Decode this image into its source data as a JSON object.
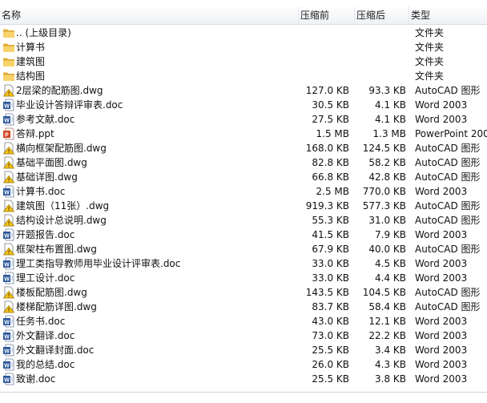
{
  "columns": {
    "name": "名称",
    "size": "压缩前",
    "compressed": "压缩后",
    "type": "类型"
  },
  "rows": [
    {
      "name": ".. (上级目录)",
      "size": "",
      "compressed": "",
      "type": "文件夹",
      "icon": "folder-icon"
    },
    {
      "name": "计算书",
      "size": "",
      "compressed": "",
      "type": "文件夹",
      "icon": "folder-icon"
    },
    {
      "name": "建筑图",
      "size": "",
      "compressed": "",
      "type": "文件夹",
      "icon": "folder-icon"
    },
    {
      "name": "结构图",
      "size": "",
      "compressed": "",
      "type": "文件夹",
      "icon": "folder-icon"
    },
    {
      "name": "2层梁的配筋图.dwg",
      "size": "127.0 KB",
      "compressed": "93.3 KB",
      "type": "AutoCAD 图形",
      "icon": "dwg-file-icon"
    },
    {
      "name": "毕业设计答辩评审表.doc",
      "size": "30.5 KB",
      "compressed": "4.1 KB",
      "type": "Word 2003",
      "icon": "word-file-icon"
    },
    {
      "name": "参考文献.doc",
      "size": "27.5 KB",
      "compressed": "4.1 KB",
      "type": "Word 2003",
      "icon": "word-file-icon"
    },
    {
      "name": "答辩.ppt",
      "size": "1.5 MB",
      "compressed": "1.3 MB",
      "type": "PowerPoint 200",
      "icon": "ppt-file-icon"
    },
    {
      "name": "横向框架配筋图.dwg",
      "size": "168.0 KB",
      "compressed": "124.5 KB",
      "type": "AutoCAD 图形",
      "icon": "dwg-file-icon"
    },
    {
      "name": "基础平面图.dwg",
      "size": "82.8 KB",
      "compressed": "58.2 KB",
      "type": "AutoCAD 图形",
      "icon": "dwg-file-icon"
    },
    {
      "name": "基础详图.dwg",
      "size": "66.8 KB",
      "compressed": "42.8 KB",
      "type": "AutoCAD 图形",
      "icon": "dwg-file-icon"
    },
    {
      "name": "计算书.doc",
      "size": "2.5 MB",
      "compressed": "770.0 KB",
      "type": "Word 2003",
      "icon": "word-file-icon"
    },
    {
      "name": "建筑图（11张）.dwg",
      "size": "919.3 KB",
      "compressed": "577.3 KB",
      "type": "AutoCAD 图形",
      "icon": "dwg-file-icon"
    },
    {
      "name": "结构设计总说明.dwg",
      "size": "55.3 KB",
      "compressed": "31.0 KB",
      "type": "AutoCAD 图形",
      "icon": "dwg-file-icon"
    },
    {
      "name": "开题报告.doc",
      "size": "41.5 KB",
      "compressed": "7.9 KB",
      "type": "Word 2003",
      "icon": "word-file-icon"
    },
    {
      "name": "框架柱布置图.dwg",
      "size": "67.9 KB",
      "compressed": "40.0 KB",
      "type": "AutoCAD 图形",
      "icon": "dwg-file-icon"
    },
    {
      "name": "理工类指导教师用毕业设计评审表.doc",
      "size": "33.0 KB",
      "compressed": "4.5 KB",
      "type": "Word 2003",
      "icon": "word-file-icon"
    },
    {
      "name": "理工设计.doc",
      "size": "33.0 KB",
      "compressed": "4.4 KB",
      "type": "Word 2003",
      "icon": "word-file-icon"
    },
    {
      "name": "楼板配筋图.dwg",
      "size": "143.5 KB",
      "compressed": "104.5 KB",
      "type": "AutoCAD 图形",
      "icon": "dwg-file-icon"
    },
    {
      "name": "楼梯配筋详图.dwg",
      "size": "83.7 KB",
      "compressed": "58.4 KB",
      "type": "AutoCAD 图形",
      "icon": "dwg-file-icon"
    },
    {
      "name": "任务书.doc",
      "size": "43.0 KB",
      "compressed": "12.1 KB",
      "type": "Word 2003",
      "icon": "word-file-icon"
    },
    {
      "name": "外文翻译.doc",
      "size": "73.0 KB",
      "compressed": "22.2 KB",
      "type": "Word 2003",
      "icon": "word-file-icon"
    },
    {
      "name": "外文翻译封面.doc",
      "size": "25.5 KB",
      "compressed": "3.4 KB",
      "type": "Word 2003",
      "icon": "word-file-icon"
    },
    {
      "name": "我的总结.doc",
      "size": "26.0 KB",
      "compressed": "4.3 KB",
      "type": "Word 2003",
      "icon": "word-file-icon"
    },
    {
      "name": "致谢.doc",
      "size": "25.5 KB",
      "compressed": "3.8 KB",
      "type": "Word 2003",
      "icon": "word-file-icon"
    }
  ]
}
